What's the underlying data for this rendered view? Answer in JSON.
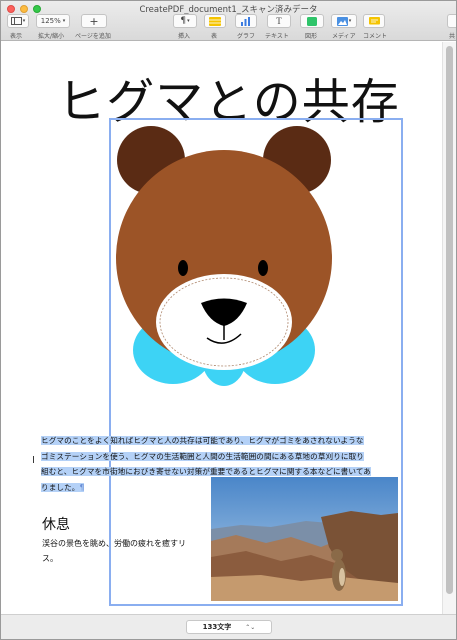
{
  "window": {
    "title": "CreatePDF_document1_スキャン済みデータ"
  },
  "toolbar": {
    "view_label": "表示",
    "zoom_value": "125%",
    "zoom_label": "拡大/縮小",
    "add_page_label": "ページを追加",
    "insert_label": "挿入",
    "table_label": "表",
    "chart_label": "グラフ",
    "text_label": "テキスト",
    "shape_label": "図形",
    "media_label": "メディア",
    "comment_label": "コメント",
    "overflow_label": "共"
  },
  "document": {
    "title": "ヒグマとの共存",
    "paragraph": "ヒグマのことをよく知ればヒグマと人の共存は可能であり、ヒグマがゴミをあされないようなゴミステーションを使う、ヒグマの生活範囲と人間の生活範囲の間にある草地の草刈りに取り組むと、ヒグマを市街地におびき寄せない対策が重要であるとヒグマに関する本などに書いてありました。",
    "pilcrow": "¶",
    "rest_heading": "休息",
    "rest_text": "渓谷の景色を眺め、労働の疲れを癒すリス。"
  },
  "status": {
    "word_count": "133文字",
    "stepper": "⌃⌄"
  },
  "colors": {
    "selection": "#b4d1f7",
    "frame": "#8aaef0",
    "bear_fur": "#9c5427",
    "bear_ears": "#5a2b14",
    "bowtie": "#3dd3f5"
  }
}
